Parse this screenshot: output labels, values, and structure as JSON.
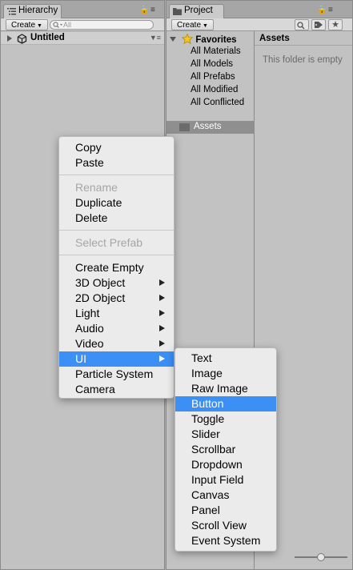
{
  "hierarchy": {
    "tab_label": "Hierarchy",
    "create_label": "Create",
    "search_placeholder": "All",
    "scene_name": "Untitled"
  },
  "project": {
    "tab_label": "Project",
    "create_label": "Create",
    "favorites_label": "Favorites",
    "favorites": [
      "All Materials",
      "All Models",
      "All Prefabs",
      "All Modified",
      "All Conflicted"
    ],
    "assets_label": "Assets",
    "right_header": "Assets",
    "empty_message": "This folder is empty"
  },
  "context_menu": {
    "items": [
      {
        "label": "Copy"
      },
      {
        "label": "Paste"
      },
      {
        "label": "Rename",
        "disabled": true
      },
      {
        "label": "Duplicate"
      },
      {
        "label": "Delete"
      },
      {
        "label": "Select Prefab",
        "disabled": true
      },
      {
        "label": "Create Empty"
      },
      {
        "label": "3D Object",
        "submenu": true
      },
      {
        "label": "2D Object",
        "submenu": true
      },
      {
        "label": "Light",
        "submenu": true
      },
      {
        "label": "Audio",
        "submenu": true
      },
      {
        "label": "Video",
        "submenu": true
      },
      {
        "label": "UI",
        "submenu": true,
        "selected": true
      },
      {
        "label": "Particle System"
      },
      {
        "label": "Camera"
      }
    ]
  },
  "ui_submenu": {
    "items": [
      {
        "label": "Text"
      },
      {
        "label": "Image"
      },
      {
        "label": "Raw Image"
      },
      {
        "label": "Button",
        "selected": true
      },
      {
        "label": "Toggle"
      },
      {
        "label": "Slider"
      },
      {
        "label": "Scrollbar"
      },
      {
        "label": "Dropdown"
      },
      {
        "label": "Input Field"
      },
      {
        "label": "Canvas"
      },
      {
        "label": "Panel"
      },
      {
        "label": "Scroll View"
      },
      {
        "label": "Event System"
      }
    ]
  },
  "colors": {
    "selection": "#3b8ff5",
    "panel_bg": "#c2c2c2",
    "menu_bg": "#ebebeb"
  }
}
